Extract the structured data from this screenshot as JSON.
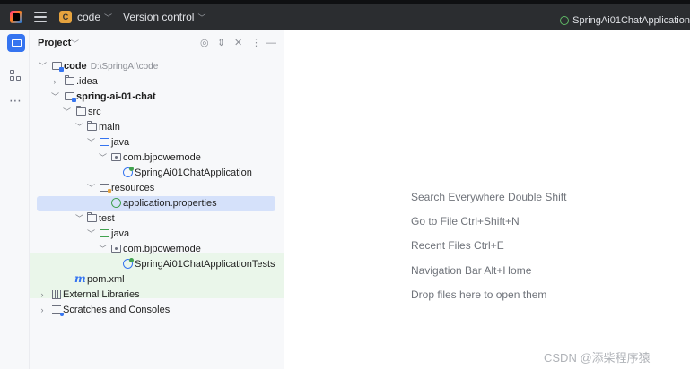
{
  "topbar": {
    "project_badge": "C",
    "project_name": "code",
    "vcs_label": "Version control",
    "run_config": "SpringAi01ChatApplication"
  },
  "tool_window": {
    "title": "Project",
    "buttons": [
      "locate-icon",
      "expand-all-icon",
      "collapse-all-icon",
      "options-icon",
      "hide-icon"
    ]
  },
  "tree": [
    {
      "label": "code",
      "path": "D:\\SpringAI\\code",
      "icon": "folder-module-icon",
      "expanded": true,
      "bold": true
    },
    {
      "label": ".idea",
      "icon": "folder-icon",
      "expanded": false
    },
    {
      "label": "spring-ai-01-chat",
      "icon": "folder-module-icon",
      "expanded": true,
      "bold": true
    },
    {
      "label": "src",
      "icon": "folder-icon",
      "expanded": true
    },
    {
      "label": "main",
      "icon": "folder-icon",
      "expanded": true
    },
    {
      "label": "java",
      "icon": "source-folder-icon",
      "expanded": true
    },
    {
      "label": "com.bjpowernode",
      "icon": "package-icon",
      "expanded": true
    },
    {
      "label": "SpringAi01ChatApplication",
      "icon": "spring-boot-class-icon"
    },
    {
      "label": "resources",
      "icon": "resources-folder-icon",
      "expanded": true
    },
    {
      "label": "application.properties",
      "icon": "spring-properties-icon",
      "selected": true
    },
    {
      "label": "test",
      "icon": "folder-icon",
      "expanded": true
    },
    {
      "label": "java",
      "icon": "test-source-folder-icon",
      "expanded": true
    },
    {
      "label": "com.bjpowernode",
      "icon": "package-icon",
      "expanded": true
    },
    {
      "label": "SpringAi01ChatApplicationTests",
      "icon": "spring-boot-test-class-icon"
    },
    {
      "label": "pom.xml",
      "icon": "maven-icon"
    },
    {
      "label": "External Libraries",
      "icon": "library-icon",
      "expanded": false
    },
    {
      "label": "Scratches and Consoles",
      "icon": "scratches-icon",
      "expanded": false
    }
  ],
  "editor_hints": [
    "Search Everywhere Double Shift",
    "Go to File Ctrl+Shift+N",
    "Recent Files Ctrl+E",
    "Navigation Bar Alt+Home",
    "Drop files here to open them"
  ],
  "watermark": "CSDN @添柴程序猿",
  "colors": {
    "topbar_bg": "#2b2d30",
    "panel_bg": "#f7f8fa",
    "selection": "#d5e1fa",
    "test_highlight": "#eaf6ea",
    "accent": "#3574f0"
  }
}
